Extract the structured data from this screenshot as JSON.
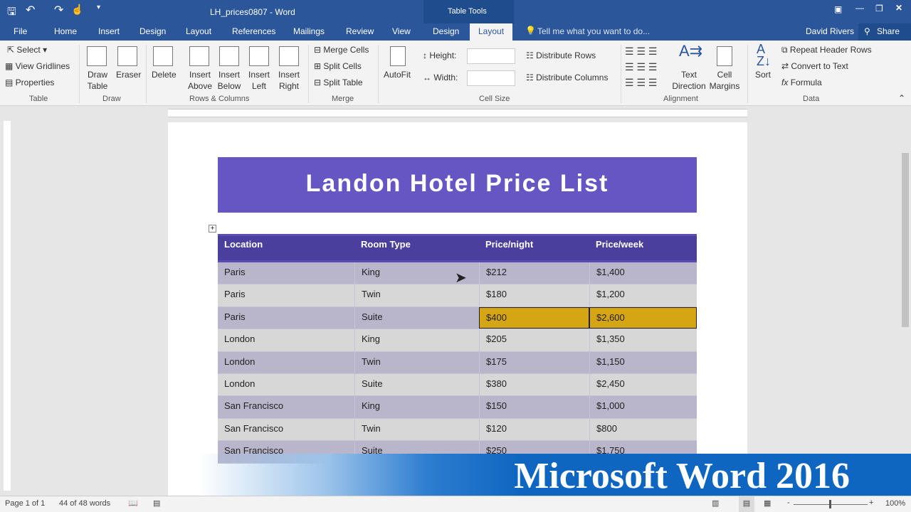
{
  "window": {
    "title": "LH_prices0807 - Word",
    "context_tab": "Table Tools",
    "user": "David Rivers",
    "share": "Share"
  },
  "tabs": [
    "File",
    "Home",
    "Insert",
    "Design",
    "Layout",
    "References",
    "Mailings",
    "Review",
    "View",
    "Design",
    "Layout"
  ],
  "tell_me": "Tell me what you want to do...",
  "ribbon": {
    "table": {
      "select": "Select",
      "view_gridlines": "View Gridlines",
      "properties": "Properties",
      "group": "Table"
    },
    "draw": {
      "draw_table": "Draw Table",
      "eraser": "Eraser",
      "group": "Draw"
    },
    "rows_cols": {
      "delete": "Delete",
      "insert_above": "Insert Above",
      "insert_below": "Insert Below",
      "insert_left": "Insert Left",
      "insert_right": "Insert Right",
      "group": "Rows & Columns"
    },
    "merge": {
      "merge_cells": "Merge Cells",
      "split_cells": "Split Cells",
      "split_table": "Split Table",
      "group": "Merge"
    },
    "cell_size": {
      "autofit": "AutoFit",
      "height": "Height:",
      "width": "Width:",
      "height_value": "",
      "width_value": "",
      "distribute_rows": "Distribute Rows",
      "distribute_columns": "Distribute Columns",
      "group": "Cell Size"
    },
    "alignment": {
      "text_direction": "Text Direction",
      "cell_margins": "Cell Margins",
      "group": "Alignment"
    },
    "data": {
      "sort": "Sort",
      "repeat_header": "Repeat Header Rows",
      "convert": "Convert to Text",
      "formula": "Formula",
      "group": "Data"
    }
  },
  "document": {
    "title": "Landon Hotel Price List",
    "headers": [
      "Location",
      "Room Type",
      "Price/night",
      "Price/week"
    ],
    "rows": [
      [
        "Paris",
        "King",
        "$212",
        "$1,400"
      ],
      [
        "Paris",
        "Twin",
        "$180",
        "$1,200"
      ],
      [
        "Paris",
        "Suite",
        "$400",
        "$2,600"
      ],
      [
        "London",
        "King",
        "$205",
        "$1,350"
      ],
      [
        "London",
        "Twin",
        "$175",
        "$1,150"
      ],
      [
        "London",
        "Suite",
        "$380",
        "$2,450"
      ],
      [
        "San Francisco",
        "King",
        "$150",
        "$1,000"
      ],
      [
        "San Francisco",
        "Twin",
        "$120",
        "$800"
      ],
      [
        "San Francisco",
        "Suite",
        "$250",
        "$1,750"
      ]
    ]
  },
  "status": {
    "page": "Page 1 of 1",
    "words": "44 of 48 words",
    "zoom": "100%"
  },
  "watermark": "Microsoft Word 2016",
  "colors": {
    "accent": "#2b579a",
    "banner": "#6656c4",
    "header": "#4a3f9c",
    "highlight": "#d6a514"
  }
}
